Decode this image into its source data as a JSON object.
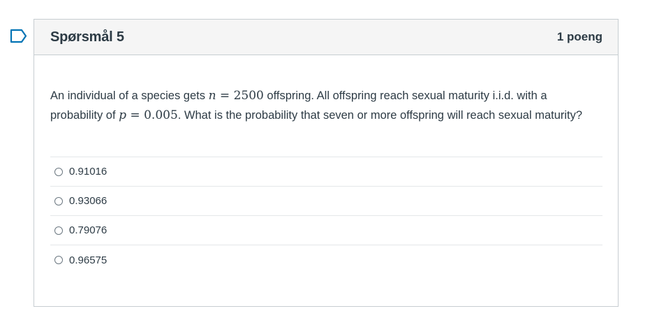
{
  "question": {
    "title": "Spørsmål 5",
    "points": "1 poeng",
    "text_parts": {
      "p1": "An individual of a species gets ",
      "n_var": "n",
      "eq1": " = ",
      "n_val": "2500",
      "p2": " offspring. All offspring reach sexual maturity i.i.d. with a probability of ",
      "p_var": "p",
      "eq2": " = ",
      "p_val": "0.005",
      "p3": ". What is the probability that seven or more offspring will reach sexual maturity?"
    },
    "answers": [
      {
        "label": "0.91016",
        "selected": false
      },
      {
        "label": "0.93066",
        "selected": false
      },
      {
        "label": "0.79076",
        "selected": false
      },
      {
        "label": "0.96575",
        "selected": false
      }
    ]
  },
  "icons": {
    "flag": "bookmark-flag-icon",
    "flag_color": "#0374b5"
  },
  "colors": {
    "text": "#2d3b45",
    "header_bg": "#f5f5f5",
    "border": "#c7cdd1",
    "divider": "#e4e7e9"
  }
}
